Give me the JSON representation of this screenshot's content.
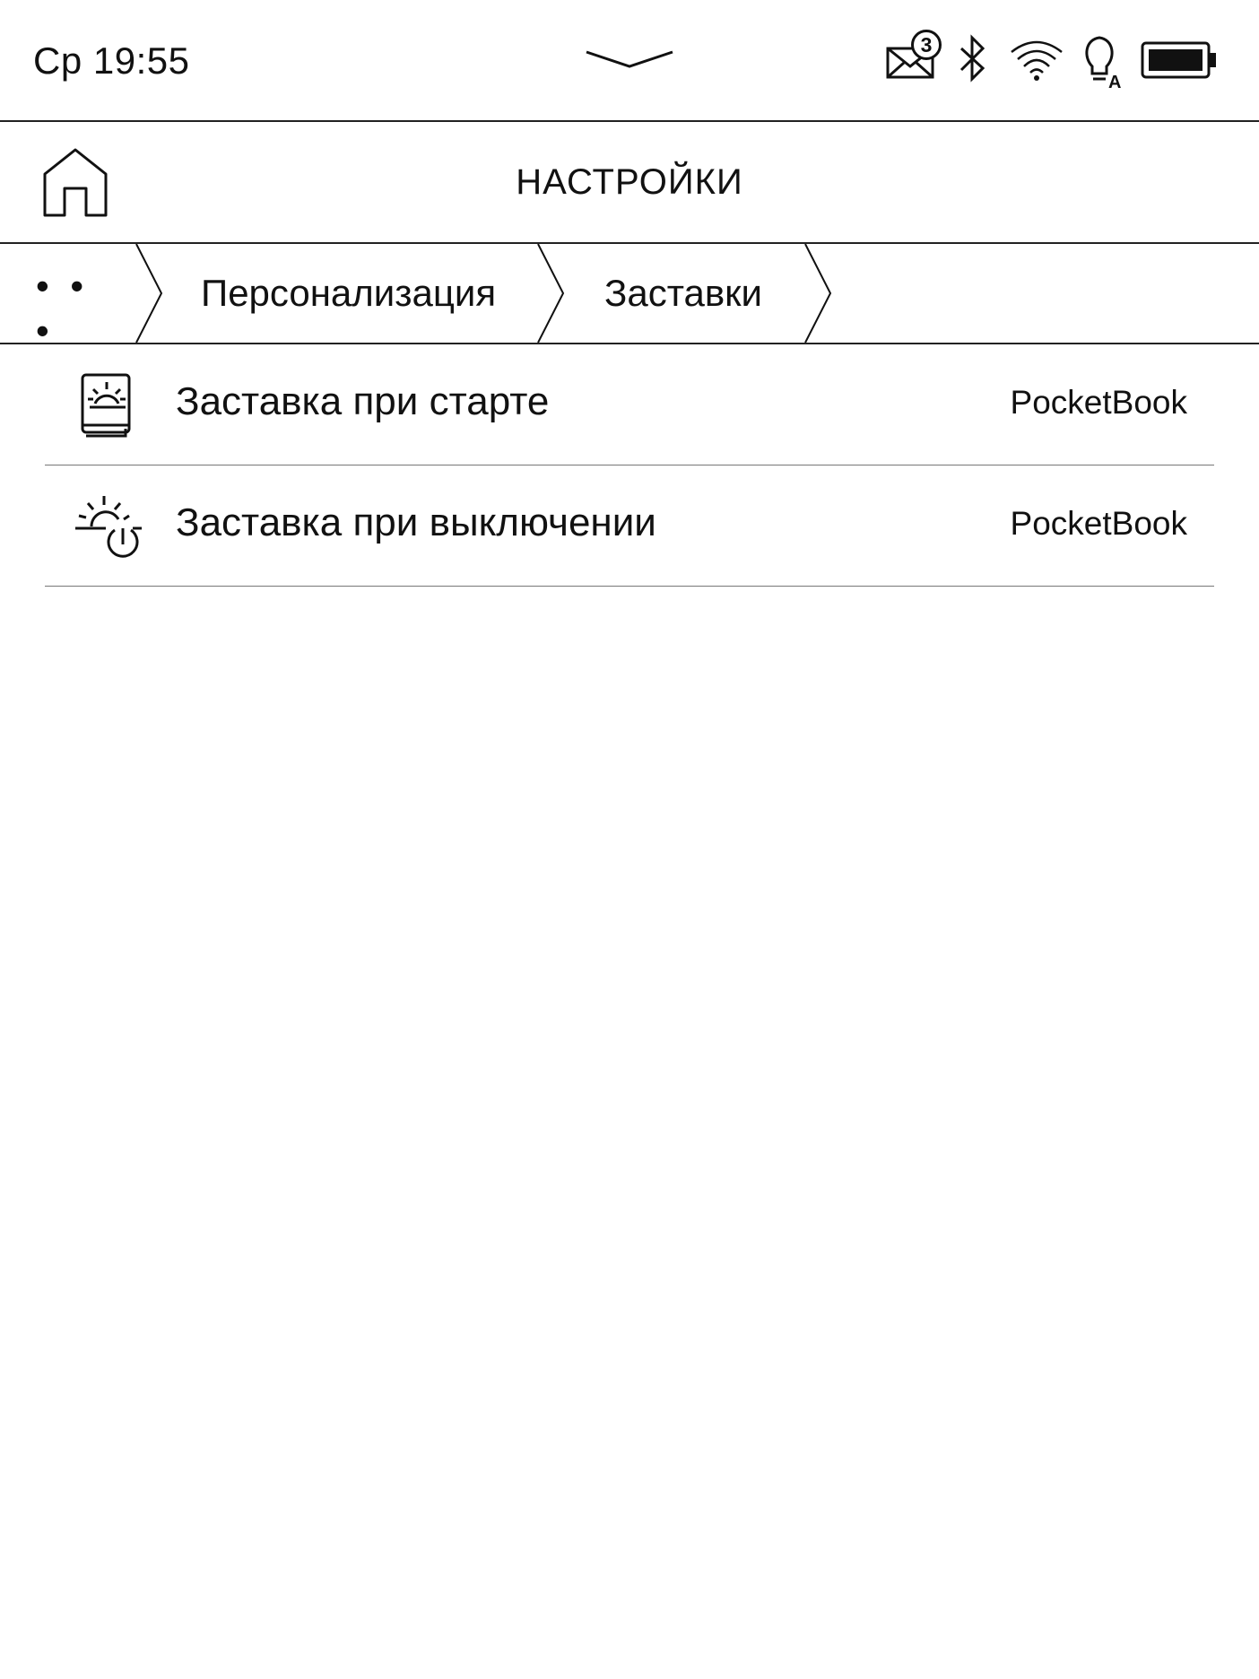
{
  "status_bar": {
    "time": "Ср 19:55",
    "mail_count": "3",
    "icons": [
      "mail-icon",
      "bluetooth-icon",
      "wifi-icon",
      "frontlight-auto-icon",
      "battery-icon"
    ]
  },
  "header": {
    "title": "НАСТРОЙКИ",
    "home_icon": "home-icon"
  },
  "breadcrumb": {
    "more": "• • •",
    "items": [
      "Персонализация",
      "Заставки"
    ]
  },
  "settings": {
    "items": [
      {
        "label": "Заставка при старте",
        "value": "PocketBook",
        "icon": "startup-logo-icon"
      },
      {
        "label": "Заставка при выключении",
        "value": "PocketBook",
        "icon": "power-off-logo-icon"
      }
    ]
  }
}
